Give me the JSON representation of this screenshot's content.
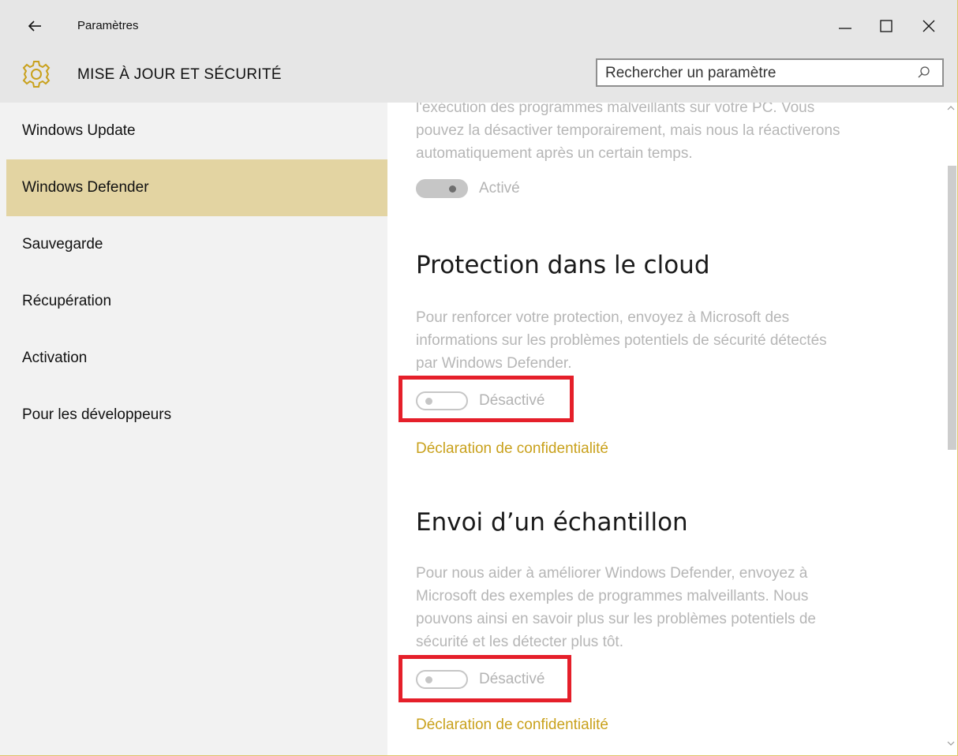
{
  "window": {
    "title": "Paramètres"
  },
  "header": {
    "title": "MISE À JOUR ET SÉCURITÉ",
    "search_placeholder": "Rechercher un paramètre",
    "icon": "gear-icon",
    "accent_color": "#c9a11c"
  },
  "sidebar": {
    "selected_index": 1,
    "items": [
      {
        "label": "Windows Update"
      },
      {
        "label": "Windows Defender"
      },
      {
        "label": "Sauvegarde"
      },
      {
        "label": "Récupération"
      },
      {
        "label": "Activation"
      },
      {
        "label": "Pour les développeurs"
      }
    ]
  },
  "content": {
    "realtime": {
      "desc_lines": [
        "l'exécution des programmes malveillants sur votre PC. Vous",
        "pouvez la désactiver temporairement, mais nous la réactiverons",
        "automatiquement après un certain temps."
      ],
      "toggle_label": "Activé",
      "toggle_on": true
    },
    "cloud": {
      "heading": "Protection dans le cloud",
      "desc_lines": [
        "Pour renforcer votre protection, envoyez à Microsoft des",
        "informations sur les problèmes potentiels de sécurité détectés",
        "par Windows Defender."
      ],
      "toggle_label": "Désactivé",
      "toggle_on": false,
      "link": "Déclaration de confidentialité"
    },
    "sample": {
      "heading": "Envoi d’un échantillon",
      "desc_lines": [
        "Pour nous aider à améliorer Windows Defender, envoyez à",
        "Microsoft des exemples de programmes malveillants. Nous",
        "pouvons ainsi en savoir plus sur les problèmes potentiels de",
        "sécurité et les détecter plus tôt."
      ],
      "toggle_label": "Désactivé",
      "toggle_on": false,
      "link": "Déclaration de confidentialité"
    }
  },
  "highlight_color": "#e51f2a"
}
